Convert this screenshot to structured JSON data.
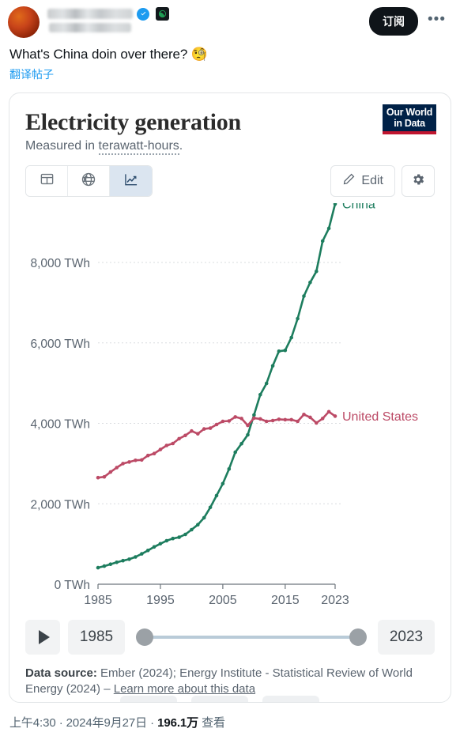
{
  "tweet": {
    "display_name_redacted": true,
    "handle_redacted": true,
    "verified_icon": "verified-badge-icon",
    "affiliate_icon": "affiliate-badge-icon",
    "subscribe_label": "订阅",
    "more_label": "•••",
    "body_text": "What's China doin over there?",
    "body_emoji": "🧐",
    "translate_label": "翻译帖子",
    "meta_time": "上午4:30",
    "meta_sep1": "·",
    "meta_date": "2024年9月27日",
    "meta_sep2": "·",
    "meta_views_count": "196.1万",
    "meta_views_label": "查看"
  },
  "chart": {
    "title": "Electricity generation",
    "subtitle_prefix": "Measured in ",
    "subtitle_term": "terawatt-hours",
    "subtitle_suffix": ".",
    "logo_line1": "Our World",
    "logo_line2": "in Data",
    "tabs": [
      {
        "name": "table-tab",
        "icon": "table-icon",
        "active": false
      },
      {
        "name": "map-tab",
        "icon": "globe-icon",
        "active": false
      },
      {
        "name": "chart-tab",
        "icon": "line-chart-icon",
        "active": true
      }
    ],
    "edit_label": "Edit",
    "settings_icon": "gear-icon",
    "timeline": {
      "play_icon": "play-icon",
      "start_year": "1985",
      "end_year": "2023"
    },
    "source": {
      "label": "Data source:",
      "text": "Ember (2024); Energy Institute - Statistical Review of World Energy (2024) –",
      "link": "Learn more about this data"
    }
  },
  "chart_data": {
    "type": "line",
    "title": "Electricity generation",
    "subtitle": "Measured in terawatt-hours.",
    "xlabel": "",
    "ylabel": "TWh",
    "xlim": [
      1985,
      2023
    ],
    "ylim": [
      0,
      9200
    ],
    "grid": true,
    "y_ticks": [
      0,
      2000,
      4000,
      6000,
      8000
    ],
    "y_tick_labels": [
      "0 TWh",
      "2,000 TWh",
      "4,000 TWh",
      "6,000 TWh",
      "8,000 TWh"
    ],
    "x_ticks": [
      1985,
      1995,
      2005,
      2015,
      2023
    ],
    "x_tick_labels": [
      "1985",
      "1995",
      "2005",
      "2015",
      "2023"
    ],
    "legend_position": "end-of-line",
    "colors": {
      "China": "#1d7d5e",
      "United States": "#bc4a66"
    },
    "x": [
      1985,
      1986,
      1987,
      1988,
      1989,
      1990,
      1991,
      1992,
      1993,
      1994,
      1995,
      1996,
      1997,
      1998,
      1999,
      2000,
      2001,
      2002,
      2003,
      2004,
      2005,
      2006,
      2007,
      2008,
      2009,
      2010,
      2011,
      2012,
      2013,
      2014,
      2015,
      2016,
      2017,
      2018,
      2019,
      2020,
      2021,
      2022,
      2023
    ],
    "series": [
      {
        "name": "China",
        "color": "#1d7d5e",
        "end_label": "China",
        "values": [
          411,
          450,
          497,
          545,
          585,
          621,
          678,
          754,
          839,
          928,
          1007,
          1081,
          1136,
          1167,
          1239,
          1356,
          1481,
          1654,
          1911,
          2203,
          2500,
          2866,
          3282,
          3495,
          3715,
          4208,
          4715,
          4994,
          5432,
          5794,
          5815,
          6133,
          6605,
          7166,
          7503,
          7779,
          8534,
          8849,
          9456
        ]
      },
      {
        "name": "United States",
        "color": "#bc4a66",
        "end_label": "United States",
        "values": [
          2650,
          2670,
          2790,
          2900,
          3000,
          3040,
          3080,
          3090,
          3200,
          3250,
          3350,
          3450,
          3500,
          3620,
          3700,
          3810,
          3740,
          3860,
          3880,
          3970,
          4050,
          4060,
          4160,
          4120,
          3950,
          4130,
          4110,
          4050,
          4070,
          4100,
          4090,
          4090,
          4050,
          4220,
          4150,
          4010,
          4120,
          4290,
          4180
        ]
      }
    ]
  }
}
